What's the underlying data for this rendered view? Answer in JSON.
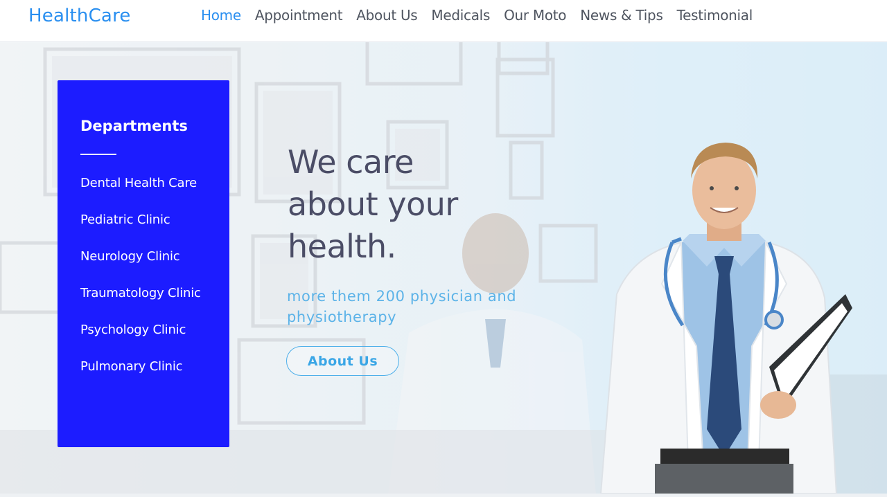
{
  "header": {
    "logo": "HealthCare",
    "nav": [
      {
        "label": "Home",
        "active": true
      },
      {
        "label": "Appointment",
        "active": false
      },
      {
        "label": "About Us",
        "active": false
      },
      {
        "label": "Medicals",
        "active": false
      },
      {
        "label": "Our Moto",
        "active": false
      },
      {
        "label": "News & Tips",
        "active": false
      },
      {
        "label": "Testimonial",
        "active": false
      }
    ]
  },
  "departments": {
    "title": "Departments",
    "items": [
      "Dental Health Care",
      "Pediatric Clinic",
      "Neurology Clinic",
      "Traumatology Clinic",
      "Psychology Clinic",
      "Pulmonary Clinic"
    ]
  },
  "hero": {
    "heading_line1": "We care",
    "heading_line2": "about your",
    "heading_line3": "health.",
    "subtitle": "more them 200 physician and physiotherapy",
    "button_label": "About Us"
  },
  "colors": {
    "accent": "#2a8ff0",
    "panel": "#1c1cff",
    "heading": "#4b4d66",
    "subtitle": "#5cb3e8"
  }
}
